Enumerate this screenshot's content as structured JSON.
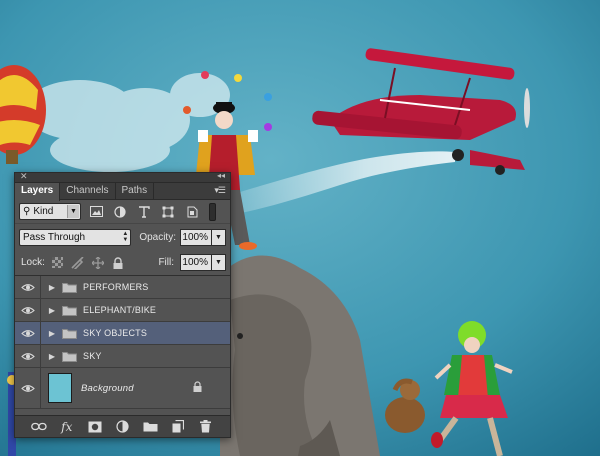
{
  "panel": {
    "tabs": [
      {
        "label": "Layers",
        "active": true
      },
      {
        "label": "Channels",
        "active": false
      },
      {
        "label": "Paths",
        "active": false
      }
    ],
    "filter": {
      "kind_label": "Kind"
    },
    "blend_mode": "Pass Through",
    "opacity": {
      "label": "Opacity:",
      "value": "100%"
    },
    "lock": {
      "label": "Lock:"
    },
    "fill": {
      "label": "Fill:",
      "value": "100%"
    },
    "layers": [
      {
        "name": "PERFORMERS",
        "type": "group",
        "selected": false
      },
      {
        "name": "ELEPHANT/BIKE",
        "type": "group",
        "selected": false
      },
      {
        "name": "SKY OBJECTS",
        "type": "group",
        "selected": true
      },
      {
        "name": "SKY",
        "type": "group",
        "selected": false
      },
      {
        "name": "Background",
        "type": "background",
        "locked": true,
        "selected": false
      }
    ]
  },
  "colors": {
    "sky": "#3b92ad",
    "panel": "#535353",
    "selected_row": "#54607a",
    "background_thumb": "#6cc3d3"
  }
}
